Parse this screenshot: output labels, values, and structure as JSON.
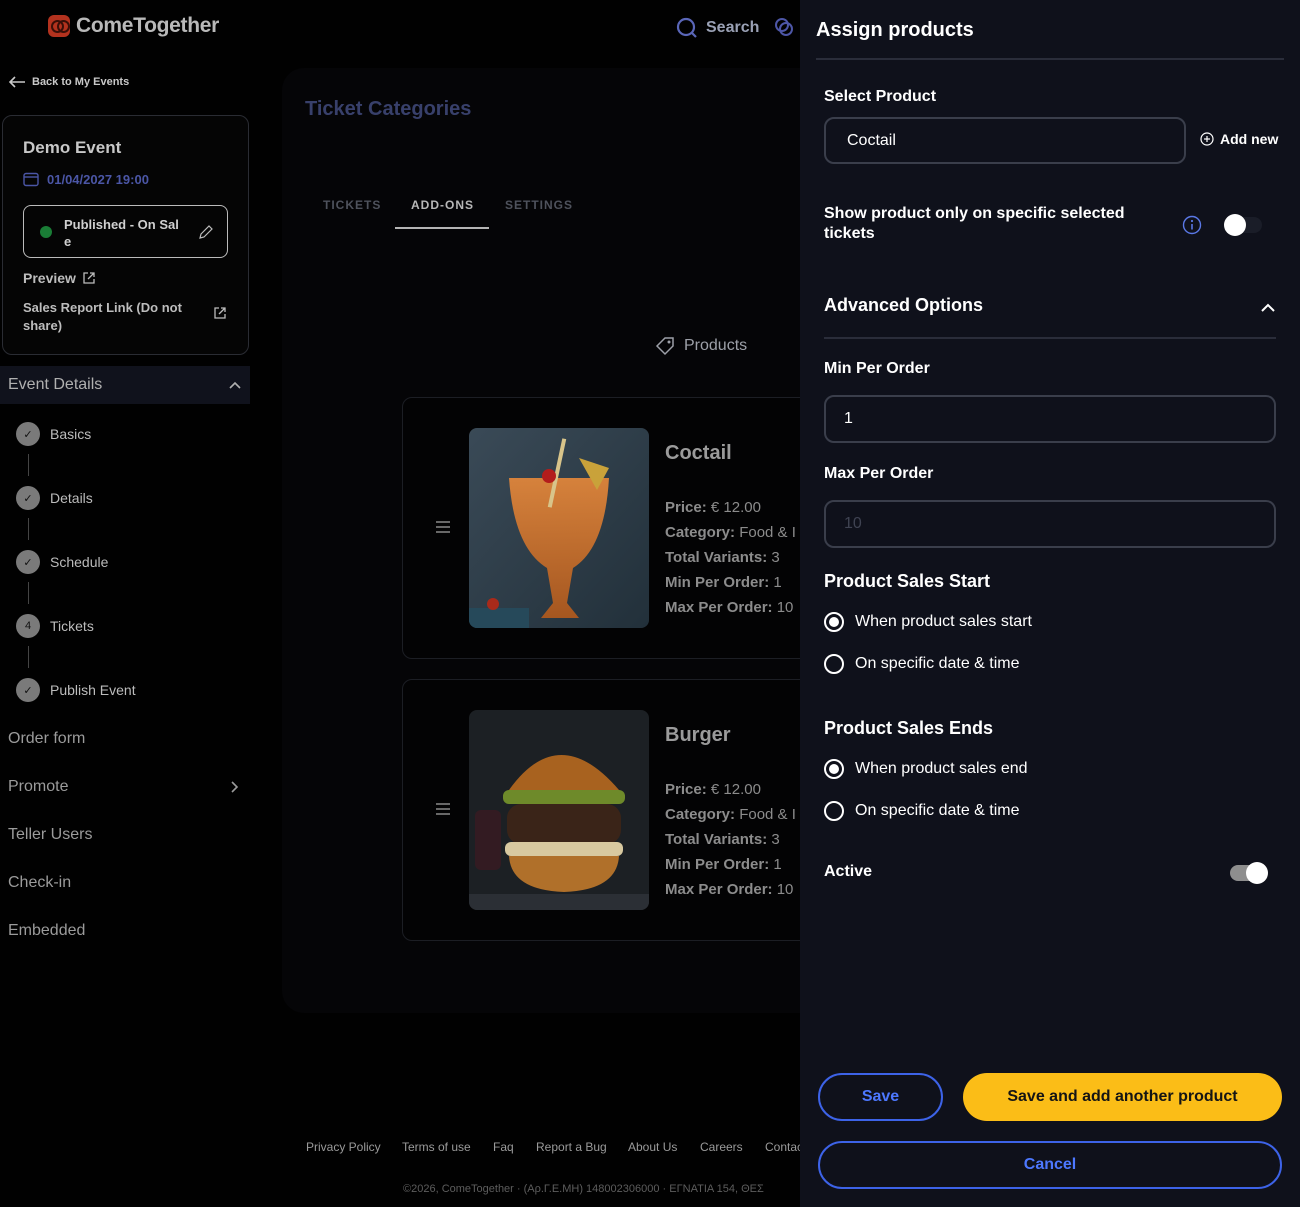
{
  "app": {
    "logo_text": "ComeTogether",
    "search_label": "Search"
  },
  "sidebar": {
    "back_label": "Back to My Events",
    "event": {
      "title": "Demo Event",
      "date": "01/04/2027 19:00",
      "status": "Published - On Sale",
      "preview_label": "Preview",
      "sales_report_label": "Sales Report Link (Do not share)"
    },
    "section_title": "Event Details",
    "steps": [
      {
        "label": "Basics",
        "marker": "✓"
      },
      {
        "label": "Details",
        "marker": "✓"
      },
      {
        "label": "Schedule",
        "marker": "✓"
      },
      {
        "label": "Tickets",
        "marker": "4"
      },
      {
        "label": "Publish Event",
        "marker": "✓"
      }
    ],
    "nav": [
      {
        "label": "Order form"
      },
      {
        "label": "Promote"
      },
      {
        "label": "Teller Users"
      },
      {
        "label": "Check-in"
      },
      {
        "label": "Embedded"
      }
    ]
  },
  "main": {
    "title": "Ticket Categories",
    "tabs": [
      {
        "label": "TICKETS",
        "active": false
      },
      {
        "label": "ADD-ONS",
        "active": true
      },
      {
        "label": "SETTINGS",
        "active": false
      }
    ],
    "products_label": "Products",
    "products": [
      {
        "name": "Coctail",
        "price_label": "Price:",
        "price": "€ 12.00",
        "category_label": "Category:",
        "category": "Food & I",
        "variants_label": "Total Variants:",
        "variants": "3",
        "min_label": "Min Per Order:",
        "min": "1",
        "max_label": "Max Per Order:",
        "max": "10"
      },
      {
        "name": "Burger",
        "price_label": "Price:",
        "price": "€ 12.00",
        "category_label": "Category:",
        "category": "Food & I",
        "variants_label": "Total Variants:",
        "variants": "3",
        "min_label": "Min Per Order:",
        "min": "1",
        "max_label": "Max Per Order:",
        "max": "10"
      }
    ]
  },
  "footer": {
    "links": [
      "Privacy Policy",
      "Terms of use",
      "Faq",
      "Report a Bug",
      "About Us",
      "Careers",
      "Contac"
    ],
    "copyright": "©2026, ComeTogether  ·  (Αρ.Γ.Ε.ΜΗ) 148002306000  ·  ΕΓΝΑΤΙΑ 154, ΘΕΣ"
  },
  "drawer": {
    "title": "Assign products",
    "select_product_label": "Select Product",
    "select_product_value": "Coctail",
    "add_new_label": "Add new",
    "show_specific_label": "Show product only on specific selected tickets",
    "show_specific_on": false,
    "advanced_label": "Advanced Options",
    "min_label": "Min Per Order",
    "min_value": "1",
    "max_label": "Max Per Order",
    "max_placeholder": "10",
    "sales_start_label": "Product Sales Start",
    "sales_start_options": [
      {
        "label": "When product sales start",
        "checked": true
      },
      {
        "label": "On specific date & time",
        "checked": false
      }
    ],
    "sales_end_label": "Product Sales Ends",
    "sales_end_options": [
      {
        "label": "When product sales end",
        "checked": true
      },
      {
        "label": "On specific date & time",
        "checked": false
      }
    ],
    "active_label": "Active",
    "active_on": true,
    "save_label": "Save",
    "save_add_label": "Save and add another product",
    "cancel_label": "Cancel"
  },
  "colors": {
    "accent_yellow": "#fbbd17",
    "accent_blue": "#3d63e8",
    "drawer_bg": "#0f111b",
    "status_green": "#1a7d36"
  }
}
